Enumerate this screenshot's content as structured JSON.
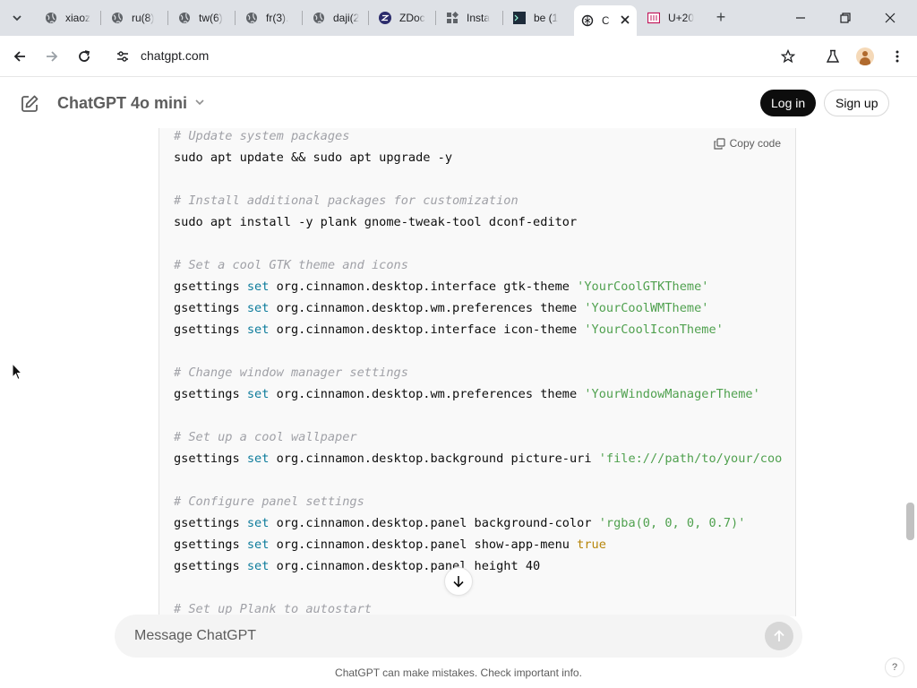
{
  "browser": {
    "tabs": [
      {
        "title": "xiaoz",
        "icon": "globe-icon"
      },
      {
        "title": "ru(8)",
        "icon": "globe-icon"
      },
      {
        "title": "tw(6)",
        "icon": "globe-icon"
      },
      {
        "title": "fr(3).",
        "icon": "globe-icon"
      },
      {
        "title": "daji(2",
        "icon": "globe-icon"
      },
      {
        "title": "ZDoc",
        "icon": "zdoc-icon"
      },
      {
        "title": "Insta",
        "icon": "install-icon"
      },
      {
        "title": "be (1",
        "icon": "terminal-icon"
      },
      {
        "title": "C",
        "icon": "chatgpt-icon",
        "active": true
      },
      {
        "title": "U+20",
        "icon": "unicode-icon"
      }
    ],
    "new_tab_label": "+",
    "url": "chatgpt.com"
  },
  "app": {
    "model_name": "ChatGPT 4o mini",
    "login_label": "Log in",
    "signup_label": "Sign up"
  },
  "code_block": {
    "copy_label": "Copy code",
    "lines": [
      [
        {
          "t": "# Update system packages",
          "k": "com"
        }
      ],
      [
        {
          "t": "sudo apt update && sudo apt upgrade -y"
        }
      ],
      [],
      [
        {
          "t": "# Install additional packages for customization",
          "k": "com"
        }
      ],
      [
        {
          "t": "sudo apt install -y plank gnome-tweak-tool dconf-editor"
        }
      ],
      [],
      [
        {
          "t": "# Set a cool GTK theme and icons",
          "k": "com"
        }
      ],
      [
        {
          "t": "gsettings "
        },
        {
          "t": "set",
          "k": "kw"
        },
        {
          "t": " org.cinnamon.desktop.interface gtk-theme "
        },
        {
          "t": "'YourCoolGTKTheme'",
          "k": "str"
        }
      ],
      [
        {
          "t": "gsettings "
        },
        {
          "t": "set",
          "k": "kw"
        },
        {
          "t": " org.cinnamon.desktop.wm.preferences theme "
        },
        {
          "t": "'YourCoolWMTheme'",
          "k": "str"
        }
      ],
      [
        {
          "t": "gsettings "
        },
        {
          "t": "set",
          "k": "kw"
        },
        {
          "t": " org.cinnamon.desktop.interface icon-theme "
        },
        {
          "t": "'YourCoolIconTheme'",
          "k": "str"
        }
      ],
      [],
      [
        {
          "t": "# Change window manager settings",
          "k": "com"
        }
      ],
      [
        {
          "t": "gsettings "
        },
        {
          "t": "set",
          "k": "kw"
        },
        {
          "t": " org.cinnamon.desktop.wm.preferences theme "
        },
        {
          "t": "'YourWindowManagerTheme'",
          "k": "str"
        }
      ],
      [],
      [
        {
          "t": "# Set up a cool wallpaper",
          "k": "com"
        }
      ],
      [
        {
          "t": "gsettings "
        },
        {
          "t": "set",
          "k": "kw"
        },
        {
          "t": " org.cinnamon.desktop.background picture-uri "
        },
        {
          "t": "'file:///path/to/your/coo",
          "k": "str"
        }
      ],
      [],
      [
        {
          "t": "# Configure panel settings",
          "k": "com"
        }
      ],
      [
        {
          "t": "gsettings "
        },
        {
          "t": "set",
          "k": "kw"
        },
        {
          "t": " org.cinnamon.desktop.panel background-color "
        },
        {
          "t": "'rgba(0, 0, 0, 0.7)'",
          "k": "str"
        }
      ],
      [
        {
          "t": "gsettings "
        },
        {
          "t": "set",
          "k": "kw"
        },
        {
          "t": " org.cinnamon.desktop.panel show-app-menu "
        },
        {
          "t": "true",
          "k": "bool"
        }
      ],
      [
        {
          "t": "gsettings "
        },
        {
          "t": "set",
          "k": "kw"
        },
        {
          "t": " org.cinnamon.desktop.panel height 40"
        }
      ],
      [],
      [
        {
          "t": "# Set up Plank to autostart",
          "k": "com"
        }
      ]
    ]
  },
  "composer": {
    "placeholder": "Message ChatGPT",
    "disclaimer": "ChatGPT can make mistakes. Check important info.",
    "help_label": "?"
  }
}
